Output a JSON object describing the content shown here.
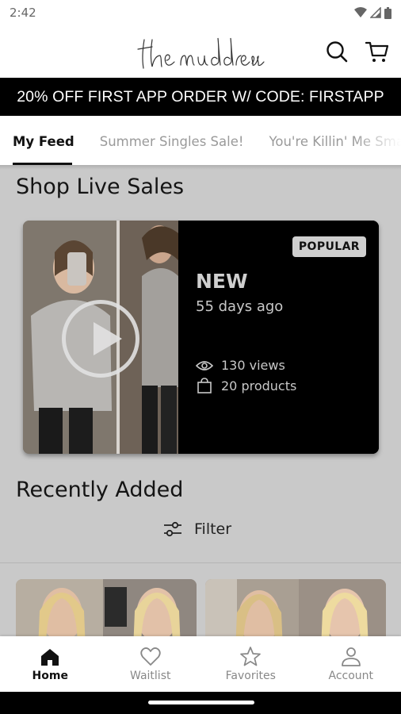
{
  "status_bar": {
    "time": "2:42",
    "icons": [
      "wifi-icon",
      "signal-icon",
      "battery-icon"
    ]
  },
  "header": {
    "logo_text": "the mud dress",
    "icons": [
      "search-icon",
      "cart-icon"
    ]
  },
  "promo": {
    "text": "20% OFF FIRST APP ORDER W/ CODE: FIRSTAPP"
  },
  "tabs": [
    {
      "label": "My Feed",
      "active": true
    },
    {
      "label": "Summer Singles Sale!",
      "active": false
    },
    {
      "label": "You're Killin' Me Smalls",
      "active": false
    }
  ],
  "live_section": {
    "title": "Shop Live Sales",
    "card": {
      "badge": "POPULAR",
      "title": "NEW",
      "date": "55 days ago",
      "views": "130 views",
      "products": "20 products"
    }
  },
  "recent_section": {
    "title": "Recently Added",
    "filter_label": "Filter"
  },
  "bottom_nav": [
    {
      "label": "Home",
      "icon": "home-icon",
      "active": true
    },
    {
      "label": "Waitlist",
      "icon": "heart-icon",
      "active": false
    },
    {
      "label": "Favorites",
      "icon": "star-icon",
      "active": false
    },
    {
      "label": "Account",
      "icon": "person-icon",
      "active": false
    }
  ],
  "colors": {
    "promo_bg": "#000000",
    "accent": "#111111",
    "overlay": "#c9c9c9"
  }
}
